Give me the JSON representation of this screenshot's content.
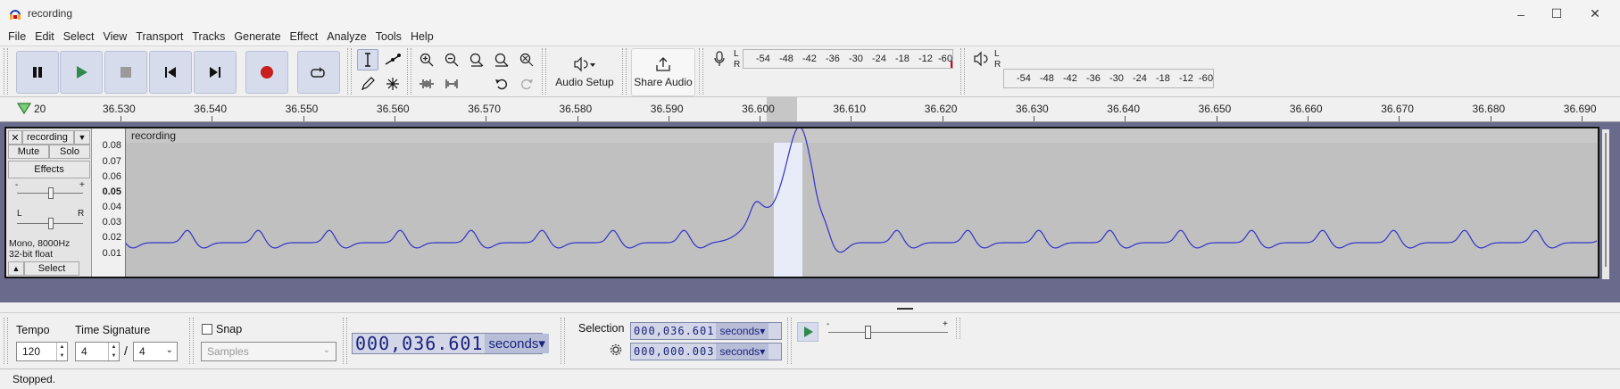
{
  "window": {
    "title": "recording"
  },
  "menu": [
    "File",
    "Edit",
    "Select",
    "View",
    "Transport",
    "Tracks",
    "Generate",
    "Effect",
    "Analyze",
    "Tools",
    "Help"
  ],
  "toolbar": {
    "audio_setup_label": "Audio Setup",
    "share_audio_label": "Share Audio",
    "record_meter_ticks": [
      "-54",
      "-48",
      "-42",
      "-36",
      "-30",
      "-24",
      "-18",
      "-12",
      "-6",
      "0"
    ],
    "play_meter_ticks": [
      "-54",
      "-48",
      "-42",
      "-36",
      "-30",
      "-24",
      "-18",
      "-12",
      "-6",
      "0"
    ],
    "meter_lr": [
      "L",
      "R"
    ]
  },
  "ruler": {
    "left_partial_label": "20",
    "labels": [
      "36.530",
      "36.540",
      "36.550",
      "36.560",
      "36.570",
      "36.580",
      "36.590",
      "36.600",
      "36.610",
      "36.620",
      "36.630",
      "36.640",
      "36.650",
      "36.660",
      "36.670",
      "36.680",
      "36.690"
    ]
  },
  "track": {
    "name": "recording",
    "clip_name": "recording",
    "mute_label": "Mute",
    "solo_label": "Solo",
    "effects_label": "Effects",
    "gain_minus": "-",
    "gain_plus": "+",
    "pan_left": "L",
    "pan_right": "R",
    "format_line1": "Mono, 8000Hz",
    "format_line2": "32-bit float",
    "select_label": "Select",
    "vscale": [
      "0.08",
      "0.07",
      "0.06",
      "0.05",
      "0.04",
      "0.03",
      "0.02",
      "0.01"
    ]
  },
  "bottom": {
    "tempo_label": "Tempo",
    "tempo_value": "120",
    "timesig_label": "Time Signature",
    "timesig_num": "4",
    "timesig_sep": "/",
    "timesig_den": "4",
    "snap_label": "Snap",
    "snap_unit": "Samples",
    "position_value": "000,036.601",
    "position_unit": "seconds",
    "selection_label": "Selection",
    "sel_start_value": "000,036.601",
    "sel_start_unit": "seconds",
    "sel_length_value": "000,000.003",
    "sel_length_unit": "seconds"
  },
  "status": {
    "text": "Stopped."
  },
  "colors": {
    "waveform": "#3232c8",
    "selection": "#e8ecf8",
    "track_bg": "#c0c0c0",
    "accent": "#d7dcec"
  }
}
